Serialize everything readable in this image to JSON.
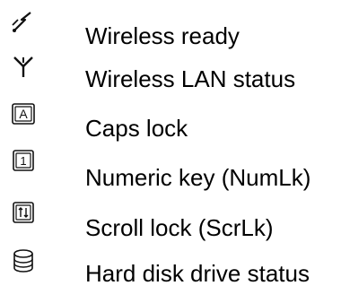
{
  "legend": {
    "items": [
      {
        "icon": "wireless-ready-icon",
        "label": "Wireless ready"
      },
      {
        "icon": "antenna-icon",
        "label": "Wireless LAN status"
      },
      {
        "icon": "caps-lock-icon",
        "label": "Caps lock"
      },
      {
        "icon": "num-lock-icon",
        "label": "Numeric key (NumLk)"
      },
      {
        "icon": "scroll-lock-icon",
        "label": "Scroll lock (ScrLk)"
      },
      {
        "icon": "hard-disk-icon",
        "label": "Hard disk drive status"
      }
    ]
  },
  "icon_glyphs": {
    "caps": "A",
    "num": "1"
  },
  "colors": {
    "text": "#000000",
    "icon": "#111111"
  }
}
